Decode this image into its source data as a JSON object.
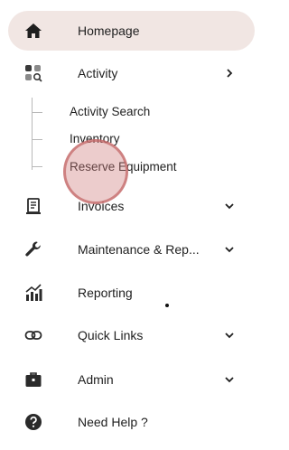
{
  "nav": {
    "homepage": {
      "label": "Homepage",
      "icon": "home-icon"
    },
    "activity": {
      "label": "Activity",
      "icon": "activity-icon"
    },
    "activity_sub": [
      {
        "label": "Activity Search"
      },
      {
        "label": "Inventory"
      },
      {
        "label": "Reserve Equipment"
      }
    ],
    "invoices": {
      "label": "Invoices",
      "icon": "invoice-icon"
    },
    "maintenance": {
      "label": "Maintenance & Rep...",
      "icon": "wrench-icon"
    },
    "reporting": {
      "label": "Reporting",
      "icon": "chart-icon"
    },
    "quick_links": {
      "label": "Quick Links",
      "icon": "link-icon"
    },
    "admin": {
      "label": "Admin",
      "icon": "briefcase-icon"
    },
    "help": {
      "label": "Need Help ?",
      "icon": "help-icon"
    }
  },
  "colors": {
    "active_bg": "#f1e6e3",
    "click_ring": "#c46868",
    "text": "#1f1f1f"
  }
}
